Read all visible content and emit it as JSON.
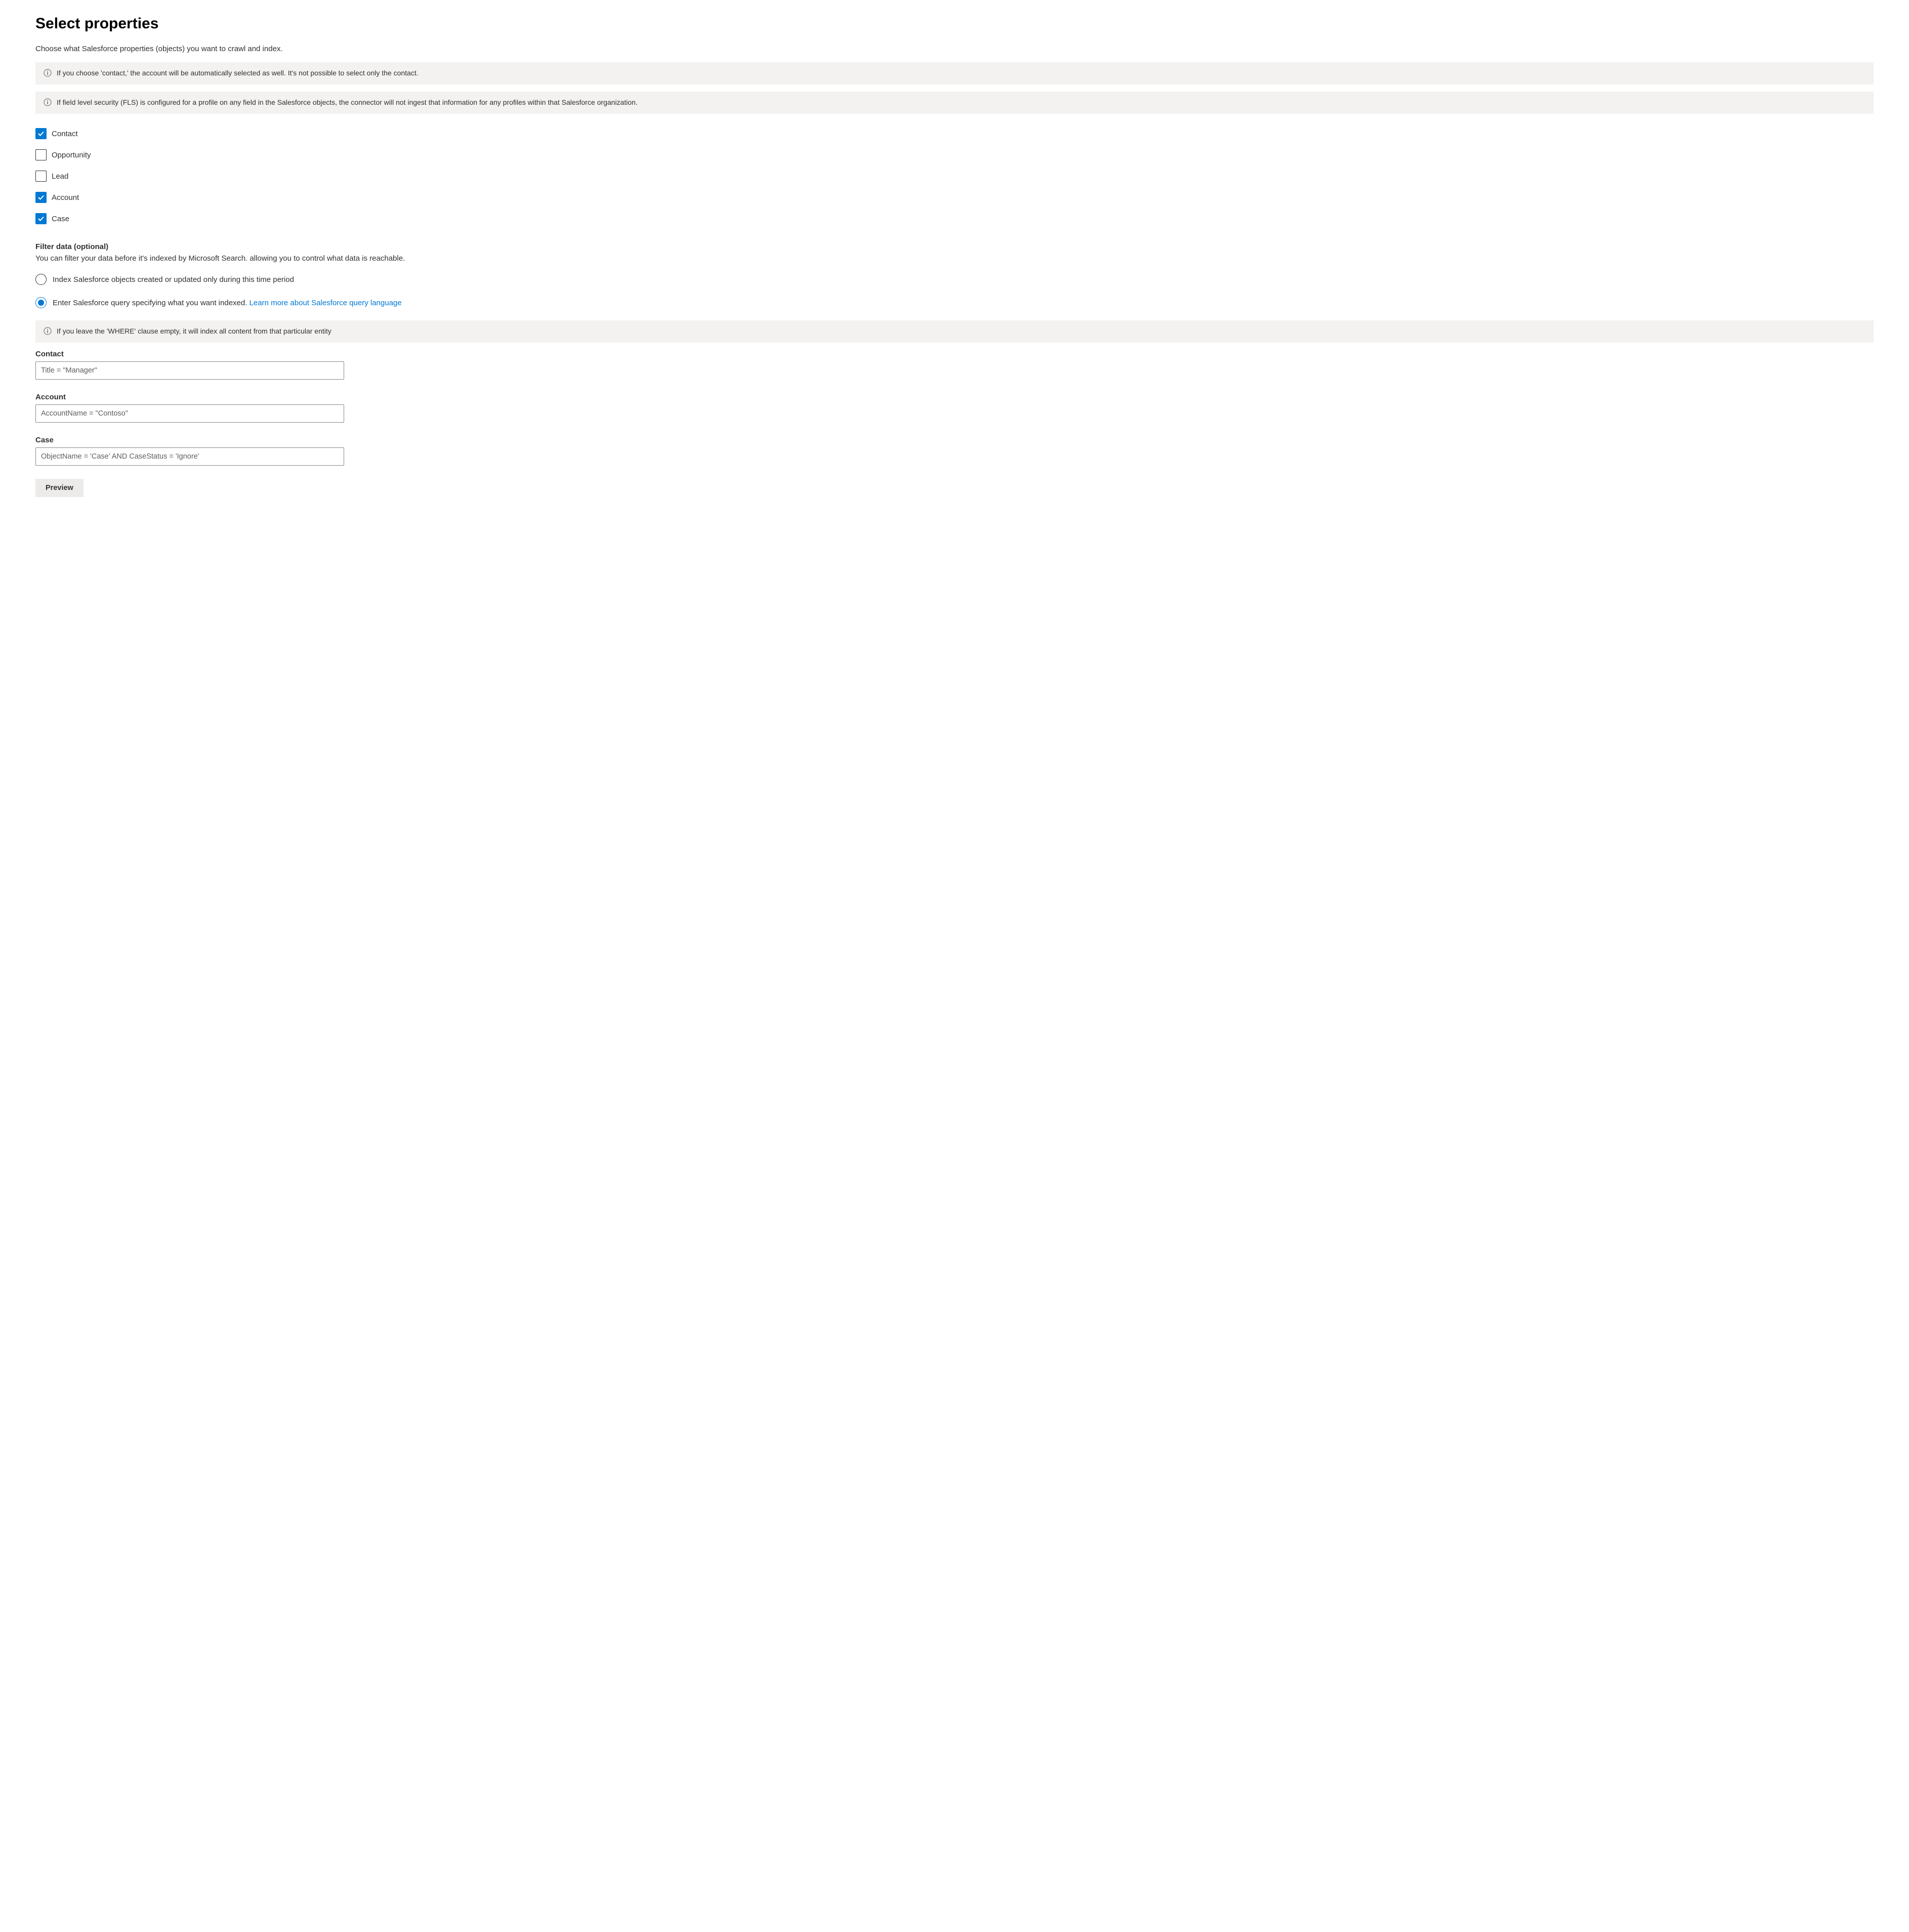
{
  "header": {
    "title": "Select properties",
    "subtitle": "Choose what Salesforce properties (objects) you want to crawl and index."
  },
  "banners": {
    "contact_auto": "If you choose 'contact,' the account will be automatically selected as well. It's not possible to select only the contact.",
    "fls": "If field level security (FLS) is configured for a profile on any field in the Salesforce objects, the connector will not ingest that information for any profiles within that Salesforce organization.",
    "where_empty": "If you leave the 'WHERE' clause empty, it will index all content from that particular entity"
  },
  "objects": [
    {
      "label": "Contact",
      "checked": true
    },
    {
      "label": "Opportunity",
      "checked": false
    },
    {
      "label": "Lead",
      "checked": false
    },
    {
      "label": "Account",
      "checked": true
    },
    {
      "label": "Case",
      "checked": true
    }
  ],
  "filter": {
    "heading": "Filter data (optional)",
    "sub": "You can filter your data before it's indexed by Microsoft Search. allowing you to control what data is reachable.",
    "radios": {
      "time_period": "Index Salesforce objects created or updated only during this time period",
      "query_prefix": "Enter Salesforce query specifying what you want indexed. ",
      "learn_more": "Learn more about Salesforce query language"
    },
    "selected": "query",
    "queries": {
      "contact": {
        "label": "Contact",
        "value": "Title = \"Manager\""
      },
      "account": {
        "label": "Account",
        "value": "AccountName = \"Contoso\""
      },
      "case": {
        "label": "Case",
        "value": "ObjectName = 'Case' AND CaseStatus = 'Ignore'"
      }
    }
  },
  "buttons": {
    "preview": "Preview"
  }
}
